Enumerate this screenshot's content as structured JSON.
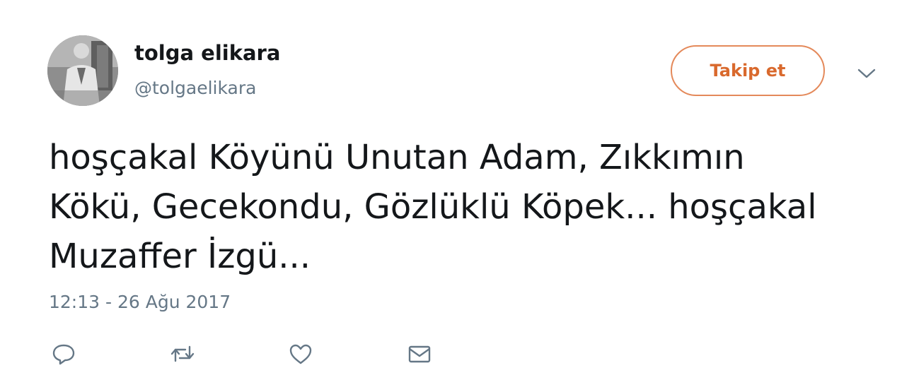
{
  "user": {
    "display_name": "tolga elikara",
    "handle": "@tolgaelikara",
    "avatar_icon": "profile-photo"
  },
  "follow_button": {
    "label": "Takip et",
    "color": "#d9692d"
  },
  "menu": {
    "icon": "chevron-down-icon"
  },
  "tweet": {
    "lines": [
      "hoşçakal Köyünü Unutan Adam, Zıkkımın",
      "Kökü, Gecekondu, Gözlüklü Köpek... hoşçakal",
      "Muzaffer İzgü..."
    ],
    "timestamp": "12:13 - 26 Ağu 2017"
  },
  "actions": [
    {
      "name": "reply",
      "icon": "reply-icon"
    },
    {
      "name": "retweet",
      "icon": "retweet-icon"
    },
    {
      "name": "like",
      "icon": "heart-icon"
    },
    {
      "name": "message",
      "icon": "envelope-icon"
    }
  ]
}
